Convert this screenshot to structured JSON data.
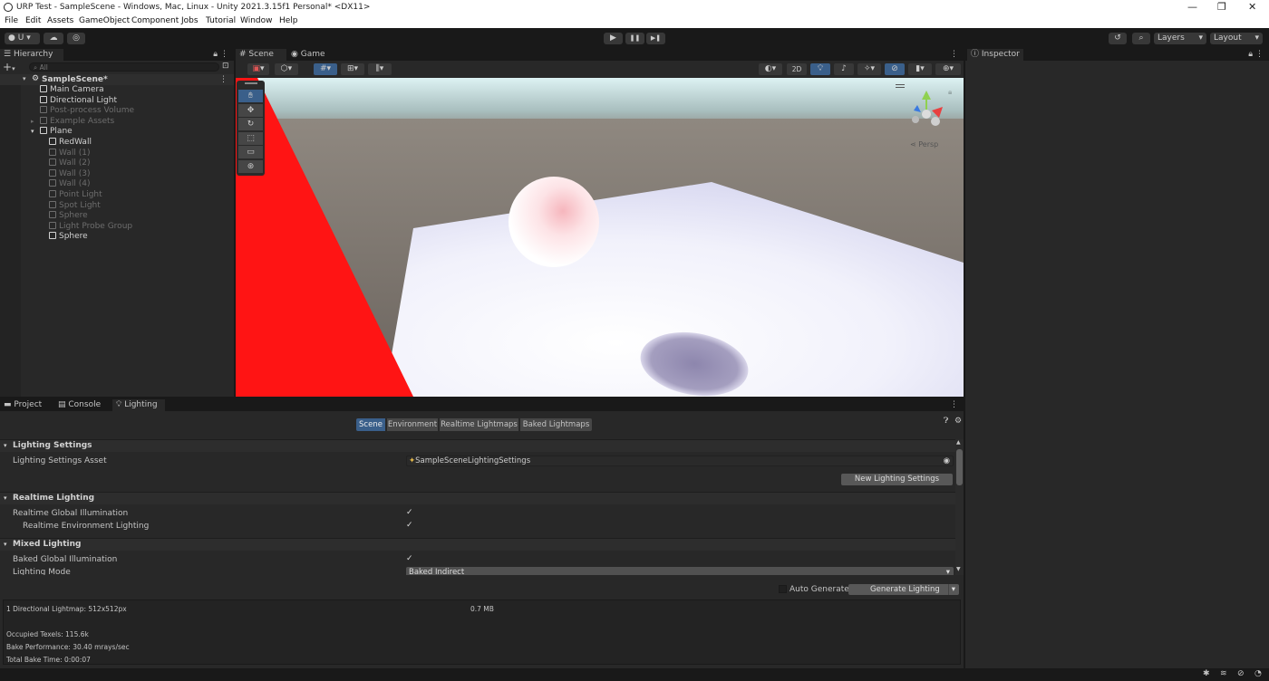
{
  "window": {
    "title": "URP Test - SampleScene - Windows, Mac, Linux - Unity 2021.3.15f1 Personal* <DX11>",
    "minimize": "—",
    "restore": "❐",
    "close": "✕"
  },
  "menu": [
    "File",
    "Edit",
    "Assets",
    "GameObject",
    "Component",
    "Jobs",
    "Tutorial",
    "Window",
    "Help"
  ],
  "toolbar": {
    "account_label": "U",
    "play": "▶",
    "pause": "❚❚",
    "step": "▶❚",
    "layers_label": "Layers",
    "layout_label": "Layout"
  },
  "hierarchy": {
    "tab_label": "Hierarchy",
    "search_placeholder": "All",
    "scene_name": "SampleScene*",
    "items": [
      {
        "label": "Main Camera",
        "state": "bright",
        "indent": 1
      },
      {
        "label": "Directional Light",
        "state": "bright",
        "indent": 1
      },
      {
        "label": "Post-process Volume",
        "state": "dim",
        "indent": 1
      },
      {
        "label": "Example Assets",
        "state": "dim",
        "indent": 1
      },
      {
        "label": "Plane",
        "state": "bright",
        "indent": 1
      },
      {
        "label": "RedWall",
        "state": "bright",
        "indent": 2
      },
      {
        "label": "Wall (1)",
        "state": "dim",
        "indent": 2
      },
      {
        "label": "Wall (2)",
        "state": "dim",
        "indent": 2
      },
      {
        "label": "Wall (3)",
        "state": "dim",
        "indent": 2
      },
      {
        "label": "Wall (4)",
        "state": "dim",
        "indent": 2
      },
      {
        "label": "Point Light",
        "state": "dim",
        "indent": 2
      },
      {
        "label": "Spot Light",
        "state": "dim",
        "indent": 2
      },
      {
        "label": "Sphere",
        "state": "dim",
        "indent": 2
      },
      {
        "label": "Light Probe Group",
        "state": "dim",
        "indent": 2
      },
      {
        "label": "Sphere",
        "state": "bright",
        "indent": 2
      }
    ]
  },
  "scene": {
    "tab_scene": "Scene",
    "tab_game": "Game",
    "btn_2d": "2D",
    "persp_label": "Persp"
  },
  "inspector": {
    "tab_label": "Inspector"
  },
  "bottom_tabs": [
    "Project",
    "Console",
    "Lighting"
  ],
  "lighting": {
    "subtabs": [
      "Scene",
      "Environment",
      "Realtime Lightmaps",
      "Baked Lightmaps"
    ],
    "sections": {
      "lighting_settings": "Lighting Settings",
      "realtime_lighting": "Realtime Lighting",
      "mixed_lighting": "Mixed Lighting"
    },
    "lighting_settings_asset_label": "Lighting Settings Asset",
    "lighting_settings_asset_value": "SampleSceneLightingSettings",
    "new_lighting_settings": "New Lighting Settings",
    "realtime_gi_label": "Realtime Global Illumination",
    "realtime_env_label": "Realtime Environment Lighting",
    "baked_gi_label": "Baked Global Illumination",
    "lighting_mode_label": "Lighting Mode",
    "lighting_mode_value": "Baked Indirect",
    "auto_generate": "Auto Generate",
    "generate_lighting": "Generate Lighting",
    "stats": {
      "lightmap": "1 Directional Lightmap: 512x512px",
      "size": "0.7 MB",
      "occupied": "Occupied Texels: 115.6k",
      "bake_perf": "Bake Performance: 30.40 mrays/sec",
      "bake_time": "Total Bake Time: 0:00:07"
    }
  },
  "colors": {
    "editor_bg": "#282828",
    "accent": "#3a5f8a",
    "red_wall": "#ff1a1a"
  }
}
